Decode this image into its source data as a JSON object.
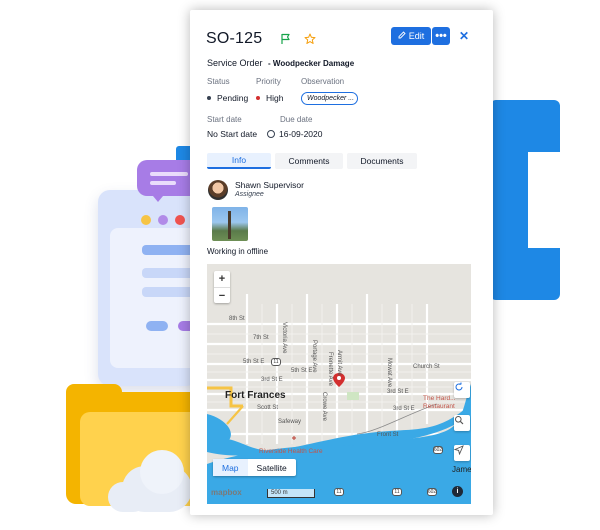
{
  "order": {
    "id": "SO-125",
    "type_label": "Service Order",
    "name": "- Woodpecker Damage"
  },
  "toolbar": {
    "edit_label": "Edit",
    "more_label": "•••",
    "close_label": "✕"
  },
  "fields": {
    "status_label": "Status",
    "status_value": "Pending",
    "priority_label": "Priority",
    "priority_value": "High",
    "observation_label": "Observation",
    "observation_value": "Woodpecker ...",
    "start_date_label": "Start date",
    "start_date_value": "No Start date",
    "due_date_label": "Due date",
    "due_date_value": "16-09-2020"
  },
  "tabs": [
    {
      "label": "Info",
      "active": true
    },
    {
      "label": "Comments",
      "active": false
    },
    {
      "label": "Documents",
      "active": false
    }
  ],
  "assignee": {
    "name": "Shawn Supervisor",
    "role": "Assignee"
  },
  "attachment": {
    "caption": "Working in offline"
  },
  "map": {
    "zoom_in": "+",
    "zoom_out": "−",
    "city": "Fort Frances",
    "streets": [
      "8th St",
      "7th St",
      "5th St E",
      "5th St E",
      "3rd St E",
      "3rd St E",
      "Scott St",
      "3rd St E",
      "Front St",
      "Victoria Ave",
      "Crowe Ave",
      "Portage Ave",
      "Armit Ave",
      "Frenette Ave",
      "Mowat Ave",
      "Church St",
      "Safeway"
    ],
    "poi_1": "The Hard... Restaurant",
    "poi_2": "Riverside Health Care",
    "edge_label": "Jame",
    "mode_map": "Map",
    "mode_satellite": "Satellite",
    "scale": "500 m",
    "attribution": "mapbox",
    "info": "i",
    "route_shields": [
      "11",
      "11",
      "11",
      "602",
      "602"
    ],
    "colors": {
      "water": "#3aa9e6",
      "land": "#e6e4df",
      "road": "#ffffff",
      "highway": "#f6c445",
      "pin": "#d32f2f"
    }
  },
  "colors": {
    "accent": "#1e6fe0",
    "flag": "#16a34a",
    "star": "#f59e0b",
    "priority_dot": "#d32f2f"
  }
}
